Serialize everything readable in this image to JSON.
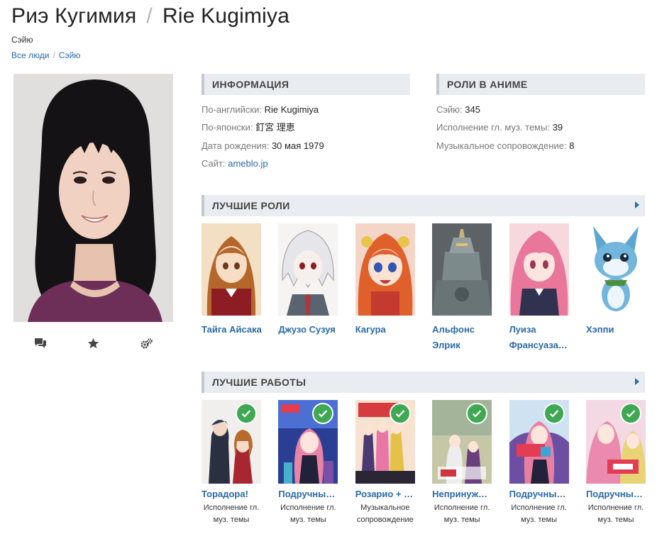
{
  "header": {
    "title_ru": "Риэ Кугимия",
    "title_sep": "/",
    "title_en": "Rie Kugimiya",
    "subtitle": "Сэйю"
  },
  "breadcrumb": {
    "items": [
      "Все люди",
      "Сэйю"
    ],
    "sep": "/"
  },
  "actions": {
    "icons": [
      "comments-icon",
      "star-icon",
      "cogs-icon"
    ]
  },
  "info": {
    "title": "Информация",
    "rows": [
      {
        "key": "По-английски:",
        "value": "Rie Kugimiya"
      },
      {
        "key": "По-японски:",
        "value": "釘宮 理恵"
      },
      {
        "key": "Дата рождения:",
        "value": "30 мая 1979"
      },
      {
        "key": "Сайт:",
        "value": "ameblo.jp"
      }
    ]
  },
  "roles": {
    "title": "Роли в аниме",
    "rows": [
      {
        "key": "Сэйю:",
        "value": "345"
      },
      {
        "key": "Исполнение гл. муз. темы:",
        "value": "39"
      },
      {
        "key": "Музыкальное сопровождение:",
        "value": "8"
      }
    ]
  },
  "best_roles": {
    "title": "Лучшие роли",
    "items": [
      {
        "name": "Тайга Айсака"
      },
      {
        "name": "Джузо Сузуя"
      },
      {
        "name": "Кагура"
      },
      {
        "name": "Альфонс Элрик"
      },
      {
        "name": "Луиза Франсуаза Ле Блан де Ла Вальер"
      },
      {
        "name": "Хэппи"
      }
    ]
  },
  "best_works": {
    "title": "Лучшие работы",
    "items": [
      {
        "name": "Торадора!",
        "role": "Исполнение гл. муз. темы"
      },
      {
        "name": "Подручный Луизы-Нулизы",
        "role": "Исполнение гл. муз. темы"
      },
      {
        "name": "Розарио + Вампир",
        "role": "Музыкальное сопровождение"
      },
      {
        "name": "Непринуждённый",
        "role": "Исполнение гл. муз. темы"
      },
      {
        "name": "Подручный Луизы-Нулизы F",
        "role": "Исполнение гл. муз. темы"
      },
      {
        "name": "Подручный Луизы-Нулизы",
        "role": "Исполнение гл. муз. темы"
      }
    ]
  },
  "colors": {
    "link": "#2a6aa6",
    "panel_bg": "#e9ecf0",
    "check_badge": "#3fa852"
  }
}
